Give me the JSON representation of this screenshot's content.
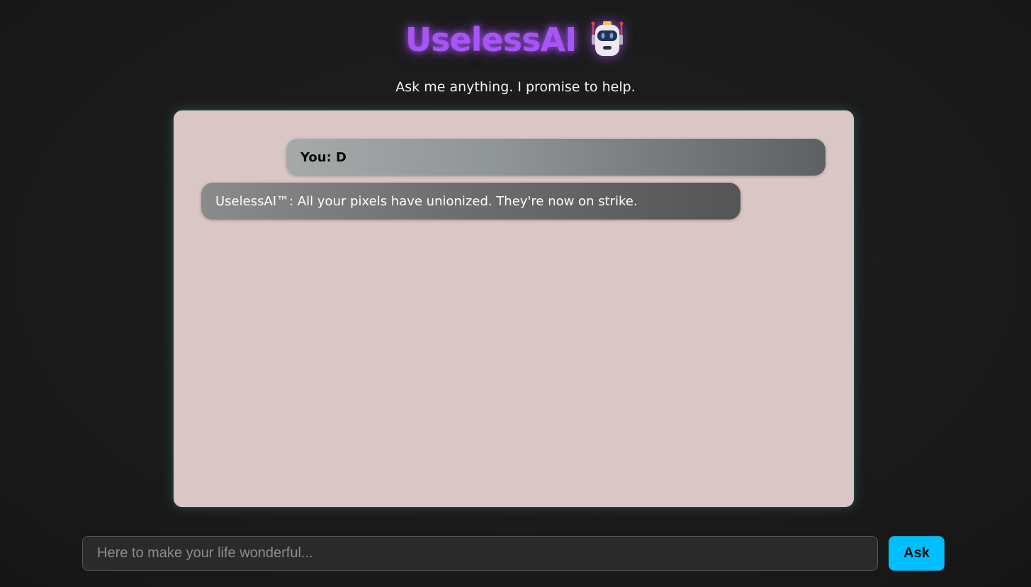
{
  "header": {
    "title": "UselessAI",
    "icon": "robot-icon",
    "subtitle": "Ask me anything. I promise to help."
  },
  "chat": {
    "messages": [
      {
        "sender": "user",
        "text": "You: D"
      },
      {
        "sender": "bot",
        "text": "UselessAI™: All your pixels have unionized. They're now on strike."
      }
    ]
  },
  "input": {
    "value": "",
    "placeholder": "Here to make your life wonderful..."
  },
  "ask_button": {
    "label": "Ask"
  },
  "colors": {
    "page_background": "#1b1b1b",
    "title": "#a855f7",
    "chat_background": "#dbc6c6",
    "ask_button": "#00bfff"
  }
}
